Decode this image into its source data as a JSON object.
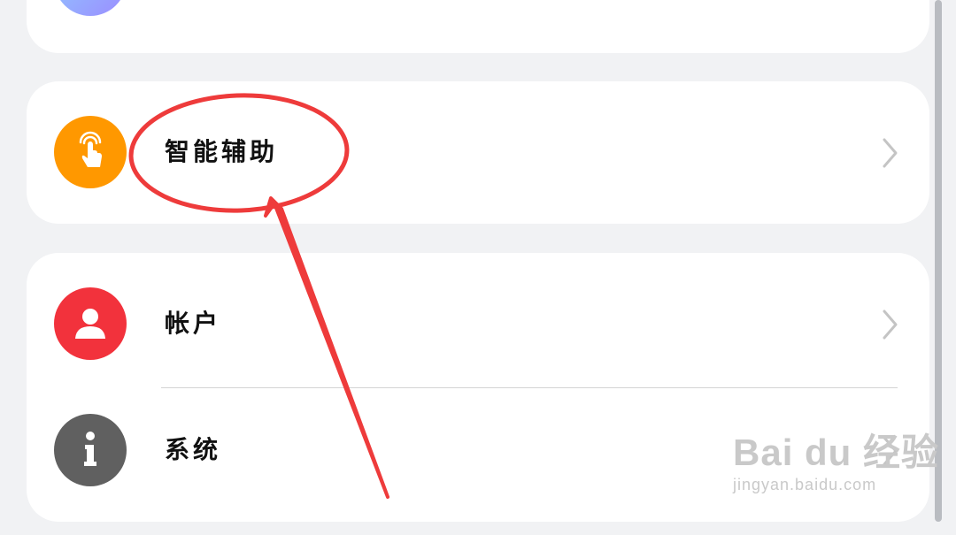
{
  "settings": {
    "items": [
      {
        "label": "智能辅助",
        "icon": "touch-hand-icon",
        "icon_color": "#ff9800"
      },
      {
        "label": "帐户",
        "icon": "user-icon",
        "icon_color": "#f2323c"
      },
      {
        "label": "系统",
        "icon": "info-icon",
        "icon_color": "#606060"
      }
    ]
  },
  "watermark": {
    "main": "Bai du 经验",
    "sub": "jingyan.baidu.com"
  },
  "colors": {
    "background": "#f1f2f4",
    "card": "#ffffff",
    "annotation": "#ee3b3b"
  }
}
